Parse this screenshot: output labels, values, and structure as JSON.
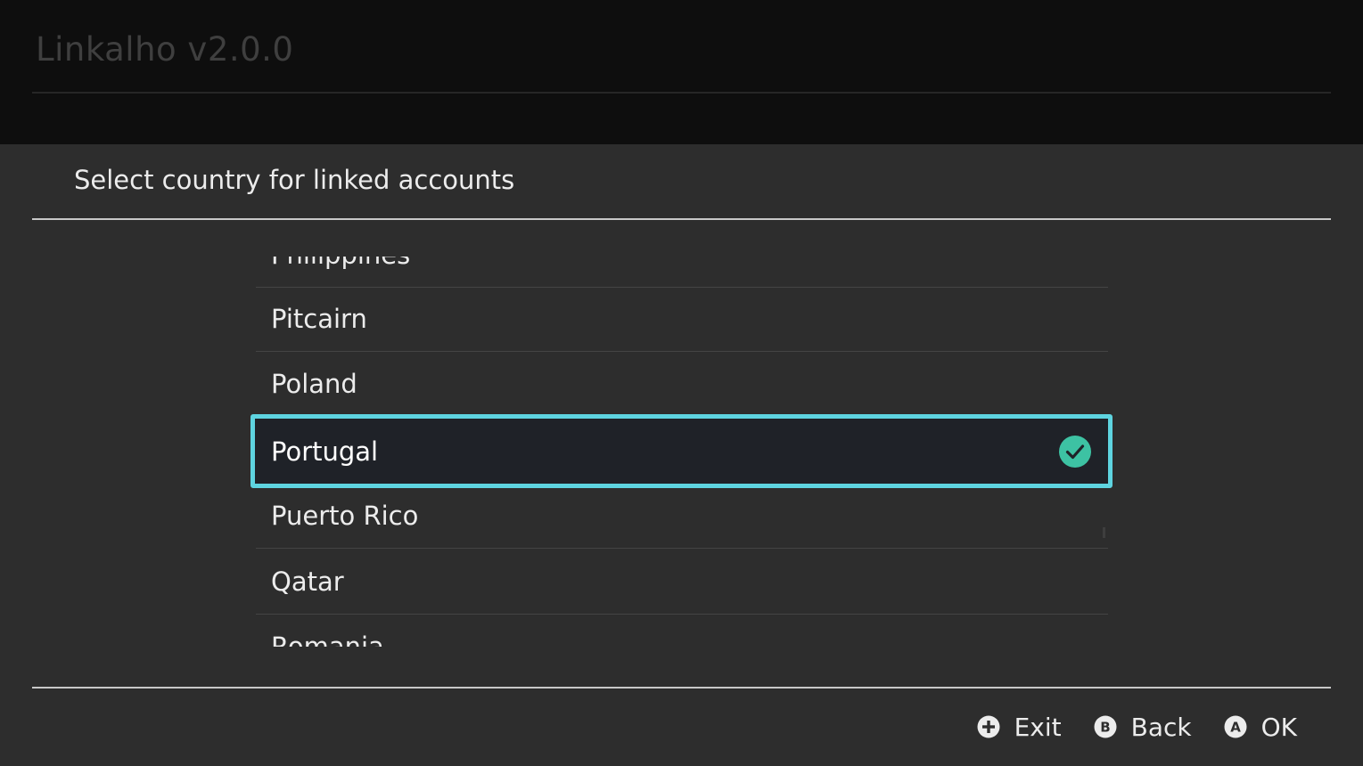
{
  "app": {
    "title": "Linkalho v2.0.0"
  },
  "dialog": {
    "title": "Select country for linked accounts",
    "list": {
      "items": [
        {
          "label": "Philippines"
        },
        {
          "label": "Pitcairn"
        },
        {
          "label": "Poland"
        },
        {
          "label": "Portugal",
          "selected": true
        },
        {
          "label": "Puerto Rico"
        },
        {
          "label": "Qatar"
        },
        {
          "label": "Romania"
        }
      ],
      "selected_label": "Portugal"
    }
  },
  "footer": {
    "hints": [
      {
        "button": "+",
        "label": "Exit",
        "icon": "plus-button-icon"
      },
      {
        "button": "B",
        "label": "Back",
        "icon": "b-button-icon"
      },
      {
        "button": "A",
        "label": "OK",
        "icon": "a-button-icon"
      }
    ]
  },
  "colors": {
    "accent_border": "#5ed4e0",
    "check_green": "#3dc2a3",
    "background": "#2d2d2d",
    "header_background": "#0e0e0e"
  }
}
